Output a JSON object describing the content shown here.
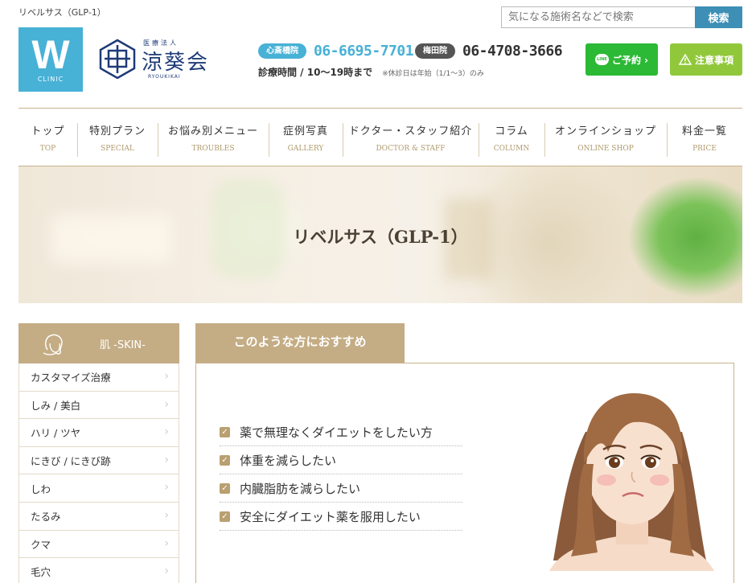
{
  "page": {
    "label": "リベルサス（GLP-1）"
  },
  "search": {
    "placeholder": "気になる施術名などで検索",
    "button": "検索"
  },
  "logo_w": {
    "letter": "W",
    "sub": "CLINIC"
  },
  "logo_ryoki": {
    "sub": "医療法人",
    "main": "涼葵会",
    "en": "RYOUKIKAI"
  },
  "phones": [
    {
      "label": "心斎橋院",
      "number": "06-6695-7701"
    },
    {
      "label": "梅田院",
      "number": "06-4708-3666"
    }
  ],
  "hours": {
    "text": "診療時間 / 10〜19時まで",
    "note": "※休診日は年始（1/1〜3）のみ"
  },
  "buttons": {
    "line_icon": "LINE",
    "reserve": "ご予約 ›",
    "caution": "注意事項"
  },
  "nav": [
    {
      "ja": "トップ",
      "en": "TOP"
    },
    {
      "ja": "特別プラン",
      "en": "SPECIAL"
    },
    {
      "ja": "お悩み別メニュー",
      "en": "TROUBLES"
    },
    {
      "ja": "症例写真",
      "en": "GALLERY"
    },
    {
      "ja": "ドクター・スタッフ紹介",
      "en": "DOCTOR & STAFF"
    },
    {
      "ja": "コラム",
      "en": "COLUMN"
    },
    {
      "ja": "オンラインショップ",
      "en": "ONLINE SHOP"
    },
    {
      "ja": "料金一覧",
      "en": "PRICE"
    }
  ],
  "hero": {
    "title": "リベルサス（GLP-1）"
  },
  "sidebar": {
    "heading": "肌 -SKIN-",
    "items": [
      "カスタマイズ治療",
      "しみ / 美白",
      "ハリ / ツヤ",
      "にきび / にきび跡",
      "しわ",
      "たるみ",
      "クマ",
      "毛穴"
    ]
  },
  "recommend": {
    "tab": "このような方におすすめ",
    "items": [
      "薬で無理なくダイエットをしたい方",
      "体重を減らしたい",
      "内臓脂肪を減らしたい",
      "安全にダイエット薬を服用したい"
    ]
  },
  "colors": {
    "accent_blue": "#48b1d6",
    "beige": "#c4ac84",
    "line_green": "#2cb935",
    "caution_green": "#91c83b"
  }
}
